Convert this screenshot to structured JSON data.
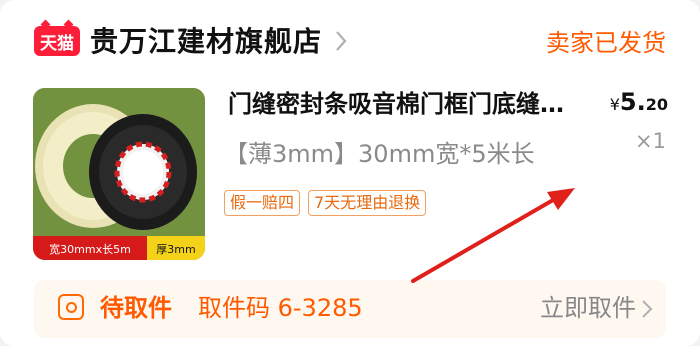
{
  "shop": {
    "platform_badge": "天猫",
    "name": "贵万江建材旗舰店",
    "order_status": "卖家已发货"
  },
  "product": {
    "title": "门缝密封条吸音棉门框门底缝…",
    "price_currency": "¥",
    "price_integer": "5.",
    "price_decimal": "20",
    "spec": "【薄3mm】30mm宽*5米长",
    "quantity": "×1",
    "tags": [
      "假一赔四",
      "7天无理由退换"
    ],
    "image_caption_size": "宽30mmx长5m",
    "image_caption_thickness": "厚3mm",
    "image_bg_color": "#6b8b3a"
  },
  "pickup": {
    "icon": "parcel-locker-icon",
    "status": "待取件",
    "code_label": "取件码 6-3285",
    "action_label": "立即取件"
  },
  "colors": {
    "accent": "#ff5a00",
    "tmall_red": "#ff1e3a",
    "annotation_arrow": "#e0201a"
  }
}
